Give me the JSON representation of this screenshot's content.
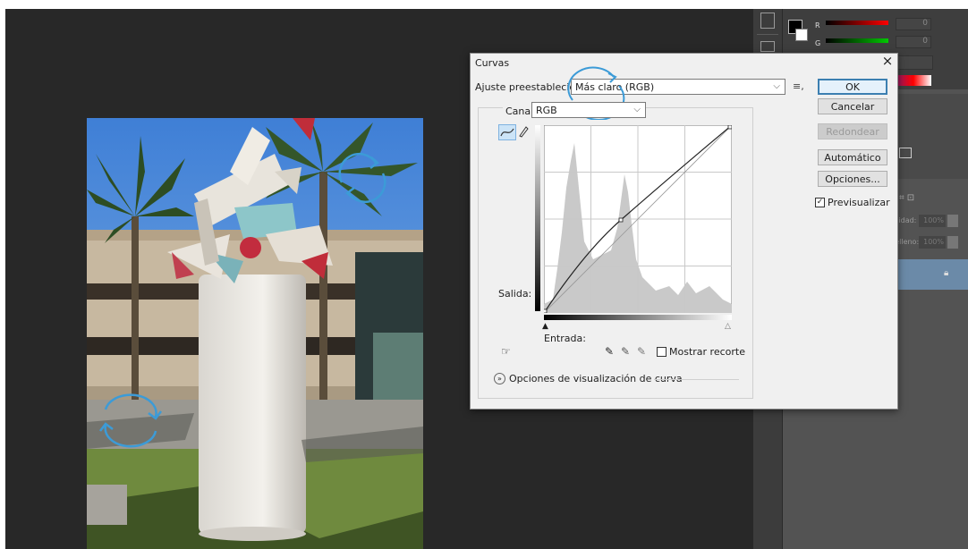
{
  "dialog": {
    "title": "Curvas",
    "close_label": "×",
    "preset_label": "Ajuste preestablecido:",
    "preset_value": "Más claro (RGB)",
    "channel_label": "Canal:",
    "channel_value": "RGB",
    "output_label": "Salida:",
    "input_label": "Entrada:",
    "show_clipping_label": "Mostrar recorte",
    "curve_display_options_label": "Opciones de visualización de curva",
    "buttons": {
      "ok": "OK",
      "cancel": "Cancelar",
      "smooth": "Redondear",
      "auto": "Automático",
      "options": "Opciones..."
    },
    "preview_label": "Previsualizar",
    "preview_checked": true
  },
  "color_panel": {
    "r_label": "R",
    "g_label": "G",
    "r_value": "0",
    "g_value": "0"
  },
  "layers_panel": {
    "opacity_label": "cidad:",
    "opacity_value": "100%",
    "fill_label": "Relleno:",
    "fill_value": "100%"
  },
  "colors": {
    "accent_blue": "#3c9bd7",
    "workspace": "#282828"
  },
  "icons": [
    "curve-point-icon",
    "pencil-icon",
    "preset-menu-icon",
    "black-eyedropper-icon",
    "gray-eyedropper-icon",
    "white-eyedropper-icon",
    "hand-adjust-icon",
    "expand-icon",
    "lock-icon",
    "rotate-arrows-icon"
  ]
}
